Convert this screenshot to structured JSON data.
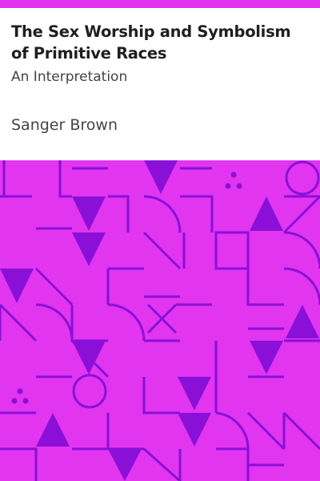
{
  "book": {
    "title": "The Sex Worship and Symbolism of Primitive Races",
    "subtitle": "An Interpretation",
    "author": "Sanger Brown"
  },
  "colors": {
    "accent": "#e030f0",
    "pattern_bg": "#e135f0",
    "pattern_line": "#8a10d8",
    "title_text": "#1f1f1f",
    "subtitle_text": "#444444"
  },
  "icons": [
    "triangle-down",
    "triangle-up",
    "circle",
    "quarter-arc",
    "three-dots",
    "x-cross",
    "diagonal-line",
    "bracket"
  ]
}
